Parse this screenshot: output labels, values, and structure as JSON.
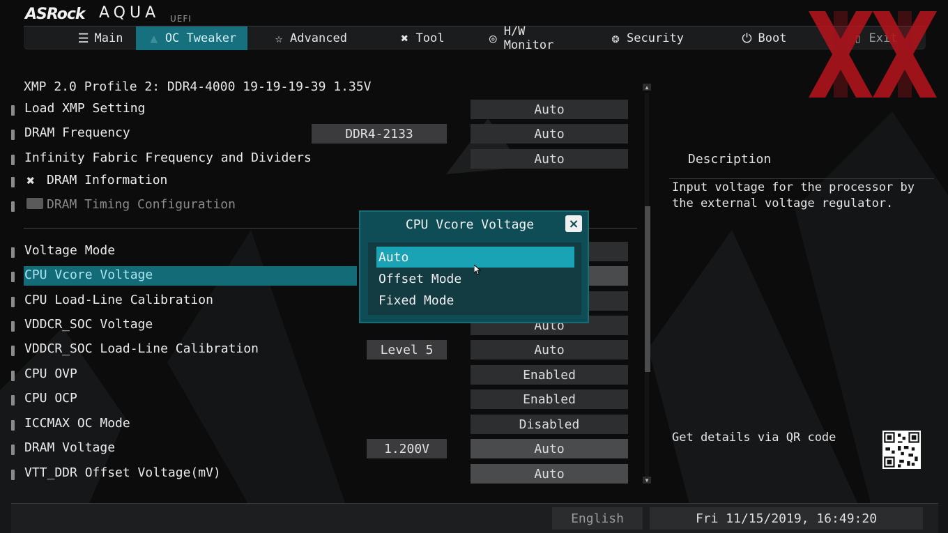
{
  "brand": {
    "name": "ASRock",
    "product": "AQUA",
    "sub": "UEFI"
  },
  "tabs": [
    {
      "id": "main",
      "label": "Main",
      "icon": "list-icon"
    },
    {
      "id": "oc",
      "label": "OC Tweaker",
      "icon": "rocket-icon"
    },
    {
      "id": "adv",
      "label": "Advanced",
      "icon": "star-icon"
    },
    {
      "id": "tool",
      "label": "Tool",
      "icon": "tools-icon"
    },
    {
      "id": "hw",
      "label": "H/W Monitor",
      "icon": "monitor-icon"
    },
    {
      "id": "sec",
      "label": "Security",
      "icon": "shield-icon"
    },
    {
      "id": "boot",
      "label": "Boot",
      "icon": "power-icon"
    },
    {
      "id": "exit",
      "label": "Exit",
      "icon": "exit-icon"
    }
  ],
  "active_tab": "OC Tweaker",
  "xmp_profile": "XMP 2.0 Profile 2: DDR4-4000 19-19-19-39 1.35V",
  "settings": [
    {
      "label": "Load XMP Setting",
      "current": "",
      "value": "Auto"
    },
    {
      "label": "DRAM Frequency",
      "current": "DDR4-2133",
      "value": "Auto"
    },
    {
      "label": "Infinity Fabric Frequency and Dividers",
      "current": "",
      "value": "Auto"
    },
    {
      "label": "DRAM Information",
      "current": "",
      "value": ""
    },
    {
      "label": "DRAM Timing Configuration",
      "current": "",
      "value": ""
    },
    {
      "label": "Voltage Mode",
      "current": "",
      "value": ""
    },
    {
      "label": "CPU Vcore Voltage",
      "current": "",
      "value": ""
    },
    {
      "label": "CPU Load-Line Calibration",
      "current": "",
      "value": ""
    },
    {
      "label": "VDDCR_SOC Voltage",
      "current": "",
      "value": "Auto"
    },
    {
      "label": "VDDCR_SOC Load-Line Calibration",
      "current": "Level 5",
      "value": "Auto"
    },
    {
      "label": "CPU OVP",
      "current": "",
      "value": "Enabled"
    },
    {
      "label": "CPU OCP",
      "current": "",
      "value": "Enabled"
    },
    {
      "label": "ICCMAX OC Mode",
      "current": "",
      "value": "Disabled"
    },
    {
      "label": "DRAM Voltage",
      "current": "1.200V",
      "value": "Auto"
    },
    {
      "label": "VTT_DDR Offset Voltage(mV)",
      "current": "",
      "value": "Auto"
    }
  ],
  "modal": {
    "title": "CPU Vcore Voltage",
    "close": "×",
    "options": [
      "Auto",
      "Offset Mode",
      "Fixed Mode"
    ],
    "selected": "Auto"
  },
  "description": {
    "title": "Description",
    "text": "Input voltage for the processor by the external voltage regulator.",
    "qr_text": "Get details via QR code"
  },
  "footer": {
    "language": "English",
    "datetime": "Fri 11/15/2019, 16:49:20"
  },
  "colors": {
    "accent": "#16707e",
    "selection": "#1aa3b5",
    "logo_red": "#b3141c"
  }
}
